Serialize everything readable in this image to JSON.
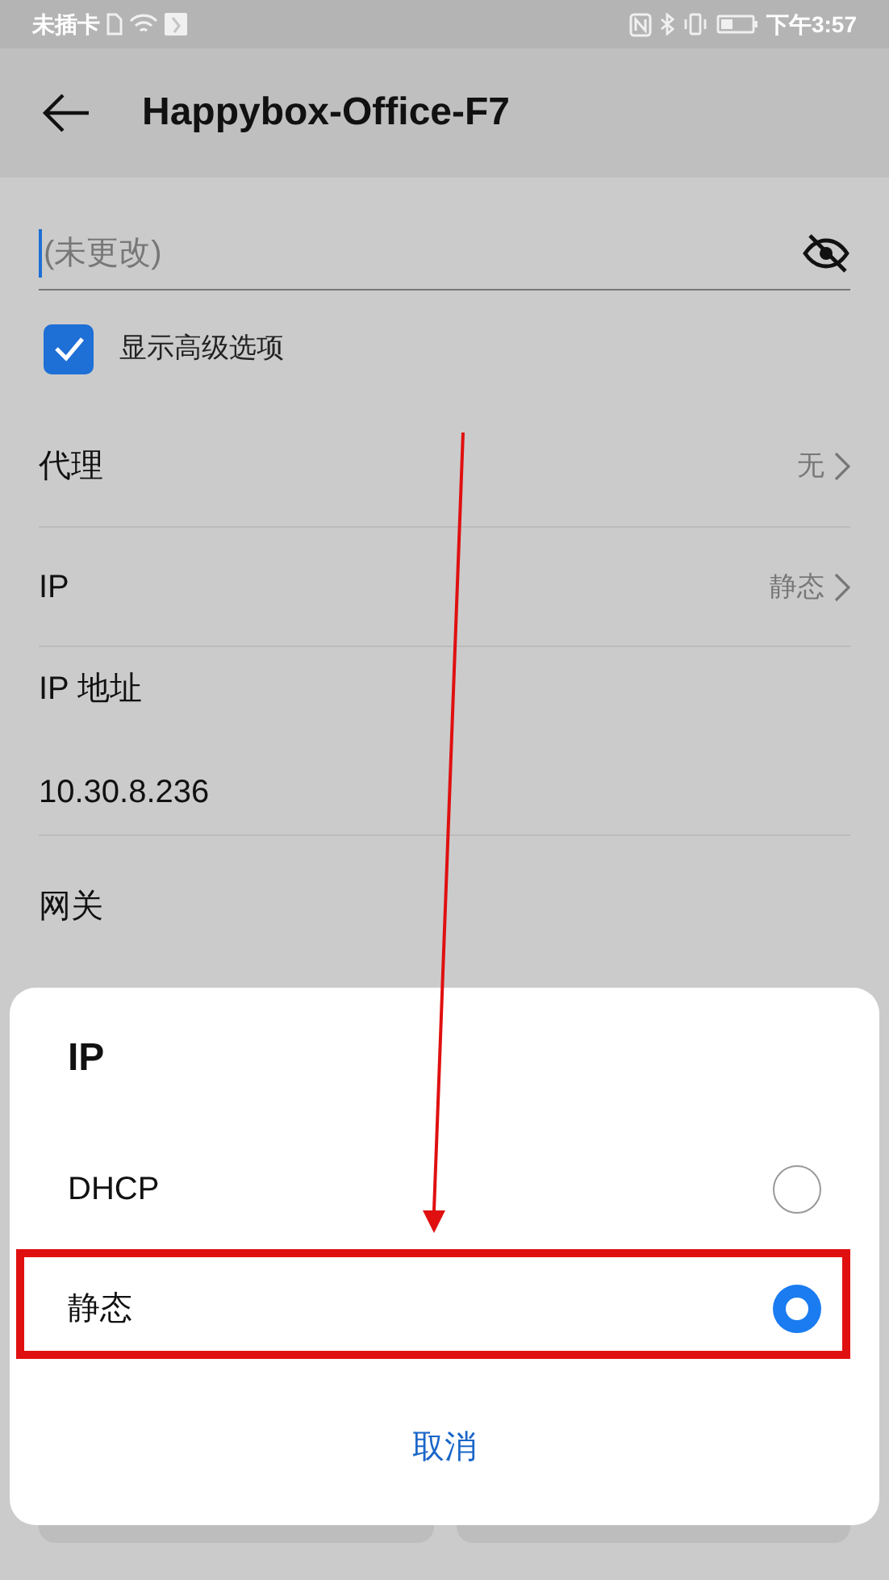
{
  "status_bar": {
    "carrier": "未插卡",
    "time": "下午3:57"
  },
  "header": {
    "title": "Happybox-Office-F7"
  },
  "password_field": {
    "placeholder": "(未更改)"
  },
  "advanced_options": {
    "label": "显示高级选项",
    "checked": true
  },
  "settings": [
    {
      "kind": "link",
      "label": "代理",
      "value": "无"
    },
    {
      "kind": "link",
      "label": "IP",
      "value": "静态"
    },
    {
      "kind": "field",
      "label": "IP 地址",
      "value": "10.30.8.236"
    },
    {
      "kind": "heading",
      "label": "网关"
    }
  ],
  "dialog": {
    "title": "IP",
    "options": [
      {
        "label": "DHCP",
        "selected": false
      },
      {
        "label": "静态",
        "selected": true
      }
    ],
    "cancel": "取消"
  }
}
